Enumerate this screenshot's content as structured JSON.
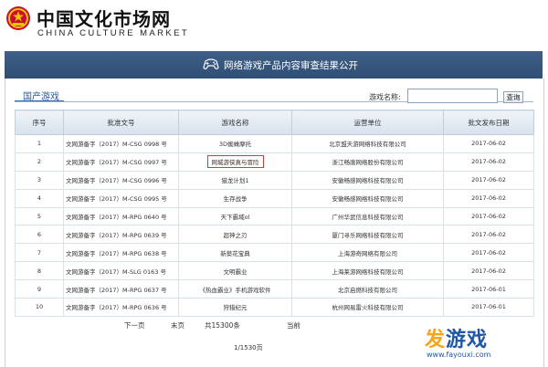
{
  "header": {
    "site_title_cn": "中国文化市场网",
    "site_title_en": "CHINA CULTURE MARKET",
    "emblem_icon": "national-emblem-icon"
  },
  "banner": {
    "icon": "gamepad-icon",
    "title": "网络游戏产品内容审查结果公开"
  },
  "tabs": [
    {
      "label": "国产游戏",
      "active": true
    }
  ],
  "search": {
    "label": "游戏名称:",
    "value": "",
    "button_label": "查询"
  },
  "table": {
    "columns": [
      "序号",
      "批准文号",
      "游戏名称",
      "运营单位",
      "批文发布日期"
    ],
    "rows": [
      {
        "no": "1",
        "approval": "文网游备字（2017）M-CSG 0998 号",
        "name": "3D蜘蛛摩托",
        "operator": "北京盟天游网络科技有限公司",
        "date": "2017-06-02"
      },
      {
        "no": "2",
        "approval": "文网游备字（2017）M-CSG 0997 号",
        "name": "网城游侠真与冒险",
        "operator": "浙江畅唐网络股份有限公司",
        "date": "2017-06-02",
        "highlight": true
      },
      {
        "no": "3",
        "approval": "文网游备字（2017）M-CSG 0996 号",
        "name": "猎龙计划1",
        "operator": "安徽畅感网络科技有限公司",
        "date": "2017-06-02"
      },
      {
        "no": "4",
        "approval": "文网游备字（2017）M-CSG 0995 号",
        "name": "生存战争",
        "operator": "安徽畅感网络科技有限公司",
        "date": "2017-06-02"
      },
      {
        "no": "5",
        "approval": "文网游备字（2017）M-RPG 0640 号",
        "name": "天下霸域ol",
        "operator": "广州华武信息科技有限公司",
        "date": "2017-06-02"
      },
      {
        "no": "6",
        "approval": "文网游备字（2017）M-RPG 0639 号",
        "name": "超神之刃",
        "operator": "厦门寻乐网络科技有限公司",
        "date": "2017-06-02"
      },
      {
        "no": "7",
        "approval": "文网游备字（2017）M-RPG 0638 号",
        "name": "新葵花宝典",
        "operator": "上海游奇网络有限公司",
        "date": "2017-06-02"
      },
      {
        "no": "8",
        "approval": "文网游备字（2017）M-SLG 0163 号",
        "name": "文明霸业",
        "operator": "上海莱游网络科技有限公司",
        "date": "2017-06-02"
      },
      {
        "no": "9",
        "approval": "文网游备字（2017）M-RPG 0637 号",
        "name": "《热血霸业》手机游戏软件",
        "operator": "北京启燃科技有限公司",
        "date": "2017-06-01"
      },
      {
        "no": "10",
        "approval": "文网游备字（2017）M-RPG 0636 号",
        "name": "狩猎纪元",
        "operator": "杭州网易雷火科技有限公司",
        "date": "2017-06-01"
      }
    ]
  },
  "pager": {
    "next": "下一页",
    "last": "末页",
    "total": "共15300条",
    "current": "当前",
    "page_count": "1/1530页"
  },
  "watermark": {
    "brand_part1": "发",
    "brand_part2": "游戏",
    "url": "www.fayouxi.com"
  },
  "colors": {
    "banner_blue": "#2f4e75",
    "highlight_red": "#d9393c",
    "watermark_orange": "#f5a51b",
    "watermark_blue": "#1f57a8"
  }
}
